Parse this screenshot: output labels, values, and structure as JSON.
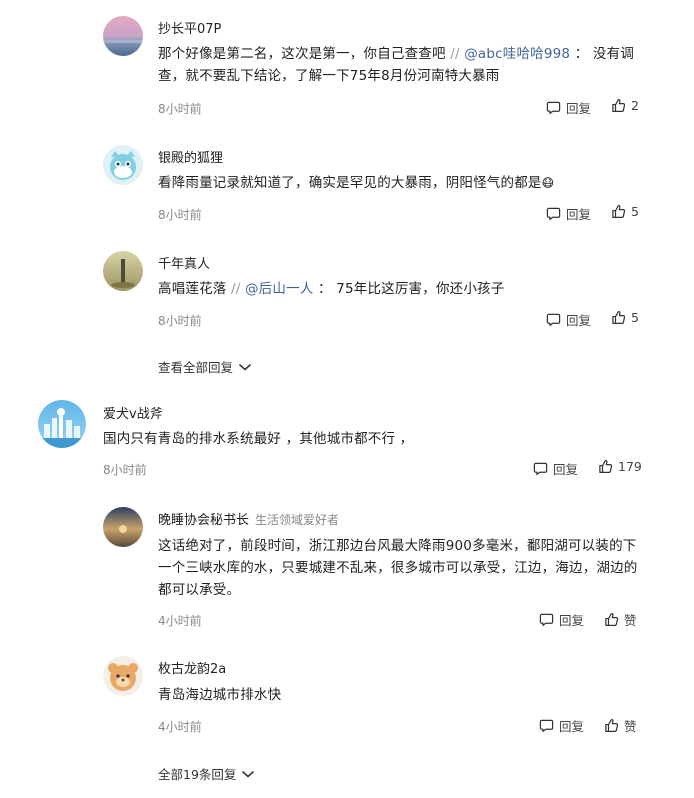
{
  "comments": [
    {
      "name": "抄长平07P",
      "tag": "",
      "text_before": "那个好像是第二名，这次是第一，你自己查查吧",
      "slash": " // ",
      "mention": "@abc哇哈哈998",
      "text_after": " ：  没有调查，就不要乱下结论，了解一下75年8月份河南特大暴雨",
      "time": "8小时前",
      "reply_label": "回复",
      "likes": "2"
    },
    {
      "name": "银殿的狐狸",
      "tag": "",
      "text_before": "看降雨量记录就知道了，确实是罕见的大暴雨，阴阳怪气的都是",
      "emoji": "😷",
      "time": "8小时前",
      "reply_label": "回复",
      "likes": "5"
    },
    {
      "name": "千年真人",
      "tag": "",
      "text_before": "高唱莲花落",
      "slash": " // ",
      "mention": "@后山一人",
      "text_after": " ：  75年比这厉害，你还小孩子",
      "time": "8小时前",
      "reply_label": "回复",
      "likes": "5"
    },
    {
      "name": "爱犬v战斧",
      "tag": "",
      "text_before": "国内只有青岛的排水系统最好 ，其他城市都不行 ，",
      "time": "8小时前",
      "reply_label": "回复",
      "likes": "179"
    },
    {
      "name": "晚睡协会秘书长",
      "tag": "生活领域爱好者",
      "text_before": "这话绝对了，前段时间，浙江那边台风最大降雨900多毫米，鄱阳湖可以装的下一个三峡水库的水，只要城建不乱来，很多城市可以承受，江边，海边，湖边的都可以承受。",
      "time": "4小时前",
      "reply_label": "回复",
      "likes": "赞"
    },
    {
      "name": "枚古龙韵2a",
      "tag": "",
      "text_before": "青岛海边城市排水快",
      "time": "4小时前",
      "reply_label": "回复",
      "likes": "赞"
    }
  ],
  "view_all_replies": "查看全部回复",
  "all_replies": "全部19条回复",
  "colors": {
    "mention": "#406599",
    "meta": "#888888",
    "text": "#222222"
  },
  "icons": [
    "comment-icon",
    "thumbs-up-icon",
    "chevron-down-icon"
  ]
}
